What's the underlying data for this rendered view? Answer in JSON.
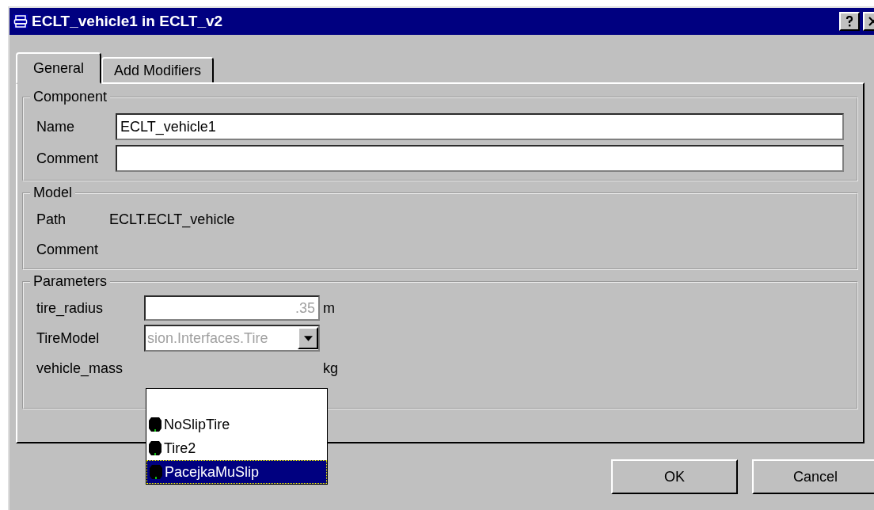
{
  "window": {
    "title": "ECLT_vehicle1 in ECLT_v2"
  },
  "tabs": [
    {
      "label": "General",
      "selected": true
    },
    {
      "label": "Add Modifiers",
      "selected": false
    }
  ],
  "component": {
    "title": "Component",
    "name_label": "Name",
    "name_value": "ECLT_vehicle1",
    "comment_label": "Comment"
  },
  "model": {
    "title": "Model",
    "path_label": "Path",
    "path_value": "ECLT.ECLT_vehicle",
    "comment_label": "Comment"
  },
  "parameters": {
    "title": "Parameters",
    "rows": [
      {
        "kind": "field",
        "label": "tire_radius",
        "value": ".35",
        "unit": "m",
        "disabled": true
      },
      {
        "kind": "combo",
        "label": "TireModel",
        "value": "sion.Interfaces.Tire",
        "disabled": true
      },
      {
        "kind": "covered",
        "label": "vehicle_mass",
        "unit": "kg"
      }
    ]
  },
  "dropdown": [
    {
      "label": "NoSlipTire",
      "selected": false
    },
    {
      "label": "Tire2",
      "selected": false
    },
    {
      "label": "PacejkaMuSlip",
      "selected": true
    }
  ],
  "buttons": [
    "OK",
    "Cancel"
  ]
}
